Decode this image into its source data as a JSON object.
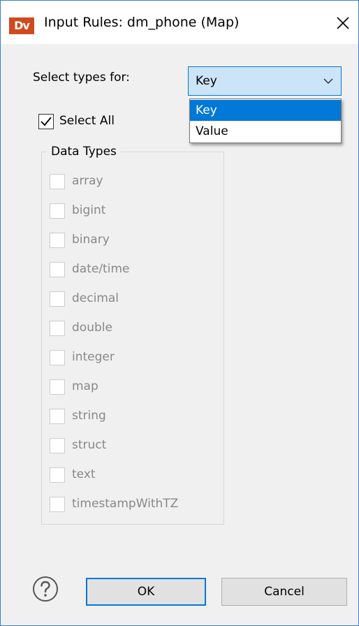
{
  "window": {
    "app_icon_text": "Dv",
    "title": "Input Rules: dm_phone (Map)",
    "close_icon": "close-x"
  },
  "select_types": {
    "label": "Select types for:",
    "selected_value": "Key",
    "options": [
      "Key",
      "Value"
    ],
    "highlighted_option": "Key"
  },
  "select_all": {
    "label": "Select All",
    "checked": true
  },
  "data_types": {
    "legend": "Data Types",
    "items": [
      {
        "label": "array",
        "checked": false,
        "enabled": false
      },
      {
        "label": "bigint",
        "checked": false,
        "enabled": false
      },
      {
        "label": "binary",
        "checked": false,
        "enabled": false
      },
      {
        "label": "date/time",
        "checked": false,
        "enabled": false
      },
      {
        "label": "decimal",
        "checked": false,
        "enabled": false
      },
      {
        "label": "double",
        "checked": false,
        "enabled": false
      },
      {
        "label": "integer",
        "checked": false,
        "enabled": false
      },
      {
        "label": "map",
        "checked": false,
        "enabled": false
      },
      {
        "label": "string",
        "checked": false,
        "enabled": false
      },
      {
        "label": "struct",
        "checked": false,
        "enabled": false
      },
      {
        "label": "text",
        "checked": false,
        "enabled": false
      },
      {
        "label": "timestampWithTZ",
        "checked": false,
        "enabled": false
      }
    ]
  },
  "footer": {
    "help_icon": "question-circle",
    "ok_label": "OK",
    "cancel_label": "Cancel"
  },
  "colors": {
    "accent": "#0078d7",
    "brand": "#d04a1f",
    "disabled_text": "#888888"
  }
}
